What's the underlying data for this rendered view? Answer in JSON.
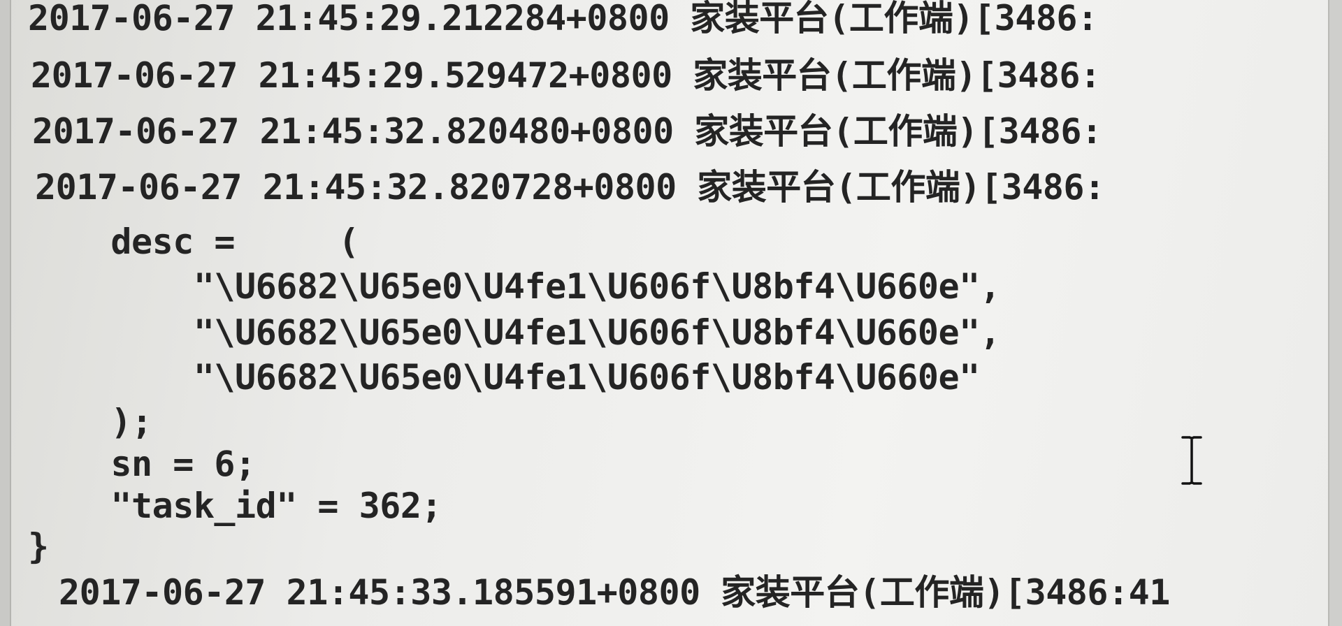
{
  "console": {
    "lines": [
      {
        "text": "2017-06-27 21:45:29.212284+0800 家装平台(工作端)[3486:"
      },
      {
        "text": "2017-06-27 21:45:29.529472+0800 家装平台(工作端)[3486:"
      },
      {
        "text": "2017-06-27 21:45:32.820480+0800 家装平台(工作端)[3486:"
      },
      {
        "text": "2017-06-27 21:45:32.820728+0800 家装平台(工作端)[3486:"
      },
      {
        "text": "    desc =     ("
      },
      {
        "text": "        \"\\U6682\\U65e0\\U4fe1\\U606f\\U8bf4\\U660e\","
      },
      {
        "text": "        \"\\U6682\\U65e0\\U4fe1\\U606f\\U8bf4\\U660e\","
      },
      {
        "text": "        \"\\U6682\\U65e0\\U4fe1\\U606f\\U8bf4\\U660e\""
      },
      {
        "text": "    );"
      },
      {
        "text": "    sn = 6;"
      },
      {
        "text": "    \"task_id\" = 362;"
      },
      {
        "text": "}"
      },
      {
        "text": "2017-06-27 21:45:33.185591+0800 家装平台(工作端)[3486:41"
      }
    ]
  },
  "cursor": {
    "icon": "text-cursor-icon"
  },
  "colors": {
    "text": "#242424",
    "background": "#efefed"
  }
}
